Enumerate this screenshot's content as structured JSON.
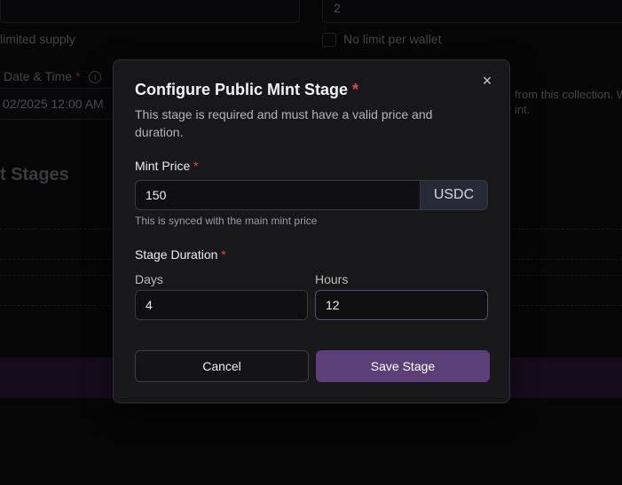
{
  "background": {
    "supply_input_value": "2",
    "unlimited_supply_label": "limited supply",
    "no_limit_label": "No limit per wallet",
    "datetime_label": "Date & Time",
    "datetime_required": "*",
    "info_icon": "i",
    "datetime_value": "02/2025 12:00 AM",
    "collection_note_line1": "from this collection. W",
    "collection_note_line2": "int.",
    "stages_heading": "t Stages"
  },
  "modal": {
    "title": "Configure Public Mint Stage",
    "required_marker": "*",
    "description": "This stage is required and must have a valid price and duration.",
    "close_icon": "×",
    "price": {
      "label": "Mint Price",
      "value": "150",
      "currency": "USDC",
      "hint": "This is synced with the main mint price"
    },
    "duration": {
      "label": "Stage Duration",
      "days_label": "Days",
      "days_value": "4",
      "hours_label": "Hours",
      "hours_value": "12"
    },
    "buttons": {
      "cancel": "Cancel",
      "save": "Save Stage"
    }
  },
  "colors": {
    "accent": "#5b3f78",
    "required": "#e0484a",
    "modal_bg": "#18181b"
  }
}
